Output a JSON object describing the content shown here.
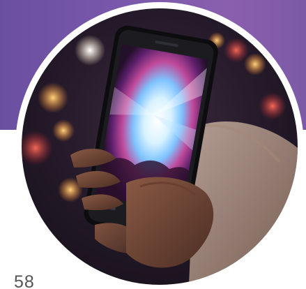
{
  "page": {
    "number": "58"
  },
  "colors": {
    "banner": "#7a58ab",
    "frame": "#ffffff",
    "page_number": "#555555"
  },
  "photo": {
    "subject": "concert-photo"
  }
}
